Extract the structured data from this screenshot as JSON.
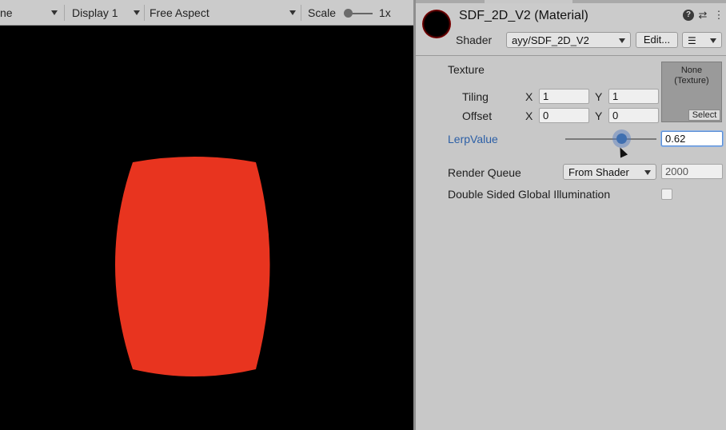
{
  "game_view": {
    "toolbar": {
      "view_partial": "ne",
      "display": "Display 1",
      "aspect": "Free Aspect",
      "scale_label": "Scale",
      "scale_value": "1x"
    },
    "shape_color": "#e8341f",
    "background_color": "#000000"
  },
  "inspector": {
    "material_title": "SDF_2D_V2 (Material)",
    "shader_label": "Shader",
    "shader_value": "ayy/SDF_2D_V2",
    "edit_button": "Edit...",
    "texture": {
      "label": "Texture",
      "slot_text_1": "None",
      "slot_text_2": "(Texture)",
      "select_button": "Select"
    },
    "tiling": {
      "label": "Tiling",
      "x_label": "X",
      "x": "1",
      "y_label": "Y",
      "y": "1"
    },
    "offset": {
      "label": "Offset",
      "x_label": "X",
      "x": "0",
      "y_label": "Y",
      "y": "0"
    },
    "lerp": {
      "label": "LerpValue",
      "value": "0.62",
      "level": 0.62
    },
    "render_queue": {
      "label": "Render Queue",
      "mode": "From Shader",
      "value": "2000"
    },
    "double_sided": {
      "label": "Double Sided Global Illumination",
      "checked": false
    },
    "accent_color": "#2c5fa6"
  }
}
